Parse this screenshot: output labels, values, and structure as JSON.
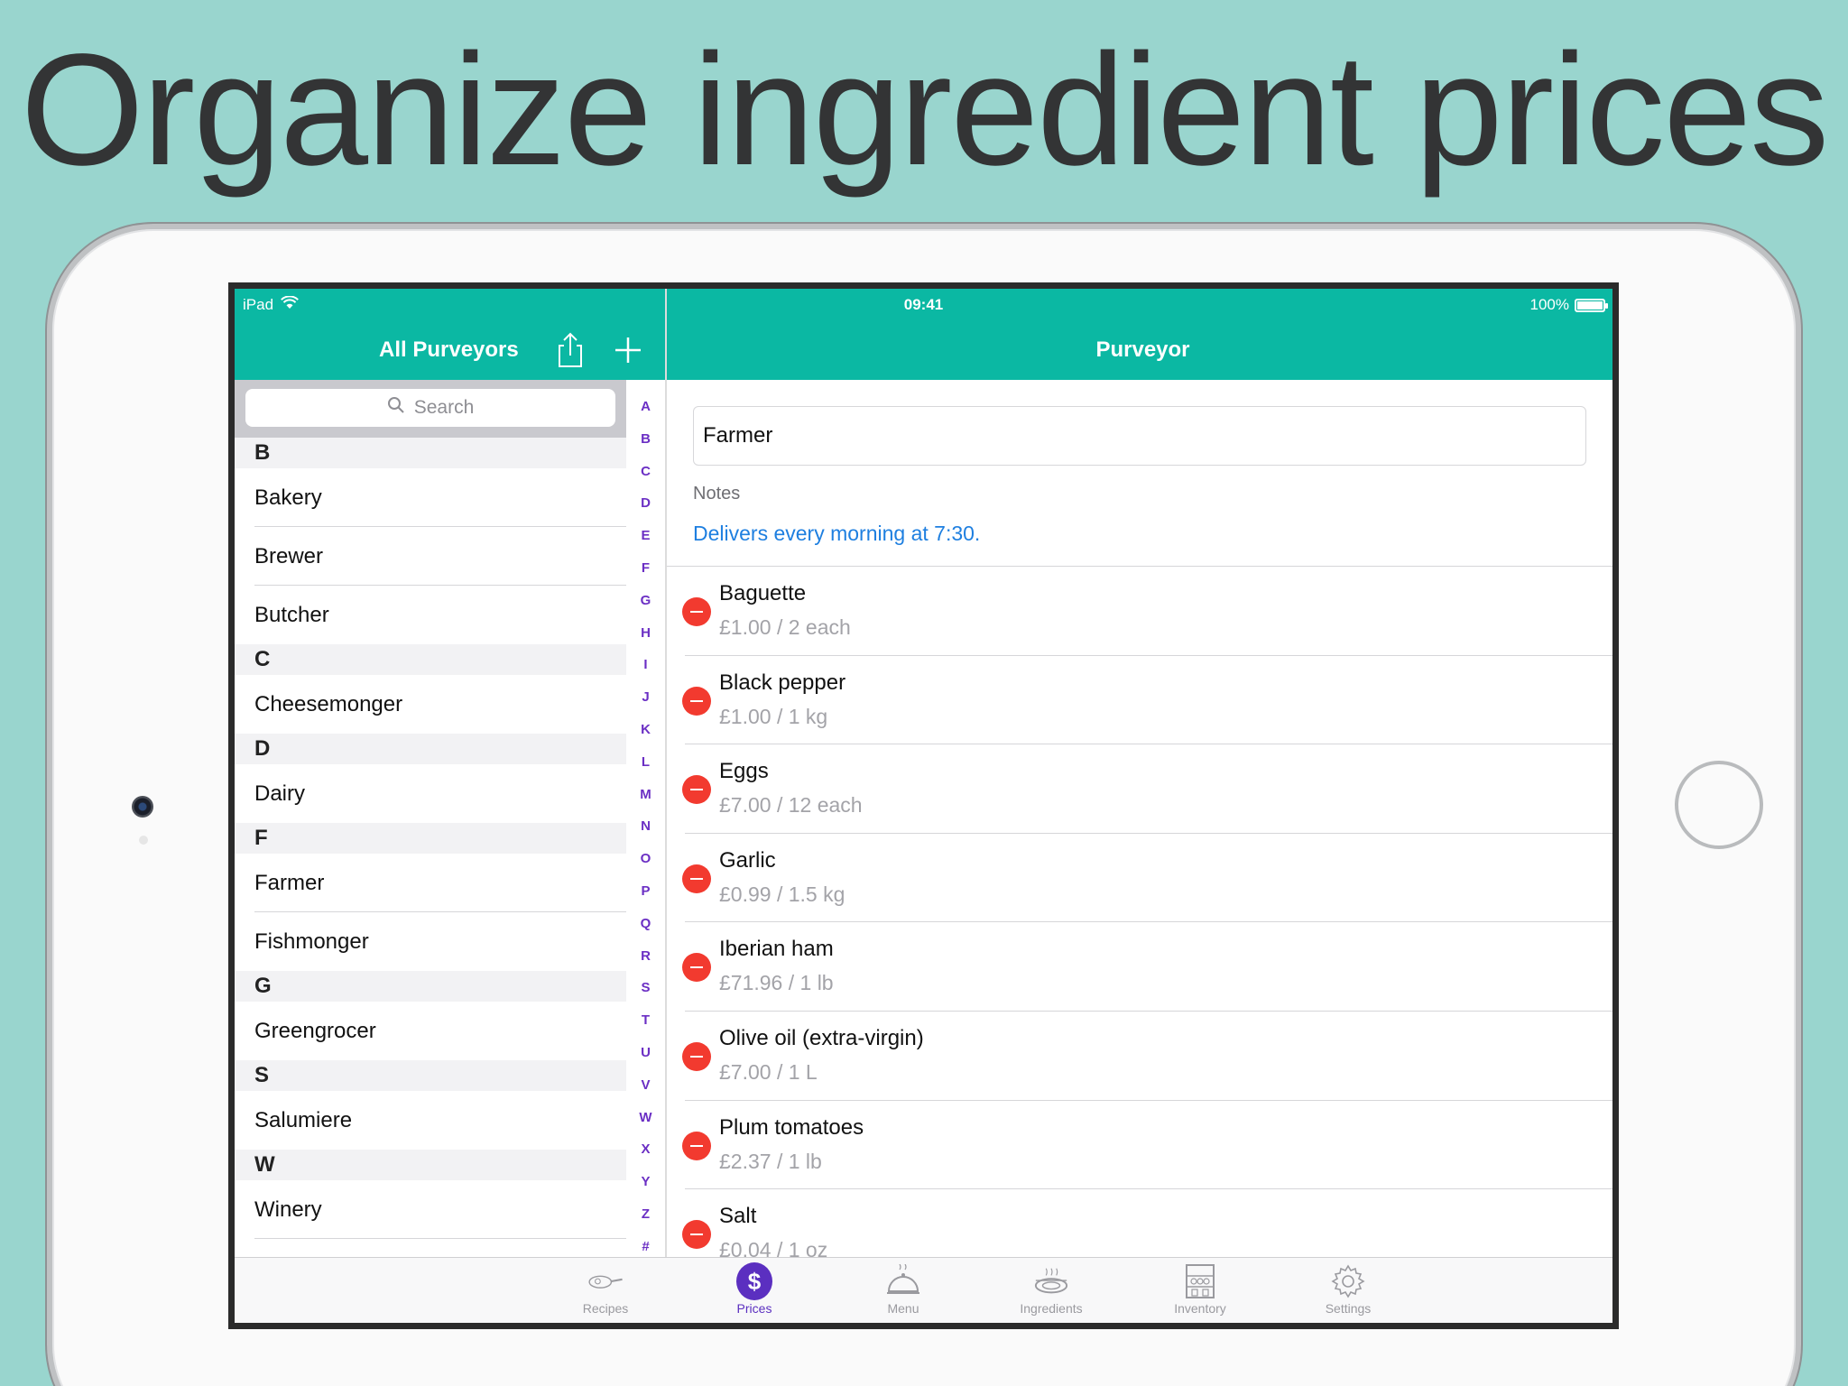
{
  "headline": "Organize ingredient prices",
  "status": {
    "device": "iPad",
    "time": "09:41",
    "battery": "100%"
  },
  "left_nav": {
    "title": "All Purveyors"
  },
  "right_nav": {
    "title": "Purveyor"
  },
  "search": {
    "placeholder": "Search"
  },
  "sections": [
    {
      "letter": "B",
      "items": [
        "Bakery",
        "Brewer",
        "Butcher"
      ]
    },
    {
      "letter": "C",
      "items": [
        "Cheesemonger"
      ]
    },
    {
      "letter": "D",
      "items": [
        "Dairy"
      ]
    },
    {
      "letter": "F",
      "items": [
        "Farmer",
        "Fishmonger"
      ]
    },
    {
      "letter": "G",
      "items": [
        "Greengrocer"
      ]
    },
    {
      "letter": "S",
      "items": [
        "Salumiere"
      ]
    },
    {
      "letter": "W",
      "items": [
        "Winery"
      ]
    }
  ],
  "index": [
    "A",
    "B",
    "C",
    "D",
    "E",
    "F",
    "G",
    "H",
    "I",
    "J",
    "K",
    "L",
    "M",
    "N",
    "O",
    "P",
    "Q",
    "R",
    "S",
    "T",
    "U",
    "V",
    "W",
    "X",
    "Y",
    "Z",
    "#"
  ],
  "purveyor": {
    "name": "Farmer",
    "notes_label": "Notes",
    "notes": "Delivers every morning at 7:30.",
    "items": [
      {
        "name": "Baguette",
        "price": "£1.00 / 2 each"
      },
      {
        "name": "Black pepper",
        "price": "£1.00 / 1 kg"
      },
      {
        "name": "Eggs",
        "price": "£7.00 / 12 each"
      },
      {
        "name": "Garlic",
        "price": "£0.99 / 1.5 kg"
      },
      {
        "name": "Iberian ham",
        "price": "£71.96 / 1 lb"
      },
      {
        "name": "Olive oil (extra-virgin)",
        "price": "£7.00 / 1 L"
      },
      {
        "name": "Plum tomatoes",
        "price": "£2.37 / 1 lb"
      },
      {
        "name": "Salt",
        "price": "£0.04 / 1 oz"
      }
    ]
  },
  "tabs": [
    {
      "label": "Recipes",
      "icon": "frying-pan-icon"
    },
    {
      "label": "Prices",
      "icon": "dollar-icon",
      "active": true
    },
    {
      "label": "Menu",
      "icon": "cloche-icon"
    },
    {
      "label": "Ingredients",
      "icon": "pot-icon"
    },
    {
      "label": "Inventory",
      "icon": "shelves-icon"
    },
    {
      "label": "Settings",
      "icon": "gear-icon"
    }
  ],
  "colors": {
    "teal": "#0bb8a3",
    "purple": "#5b2fc0",
    "red": "#f23a2f",
    "link": "#1e7fe0",
    "background": "#99d5ce"
  }
}
